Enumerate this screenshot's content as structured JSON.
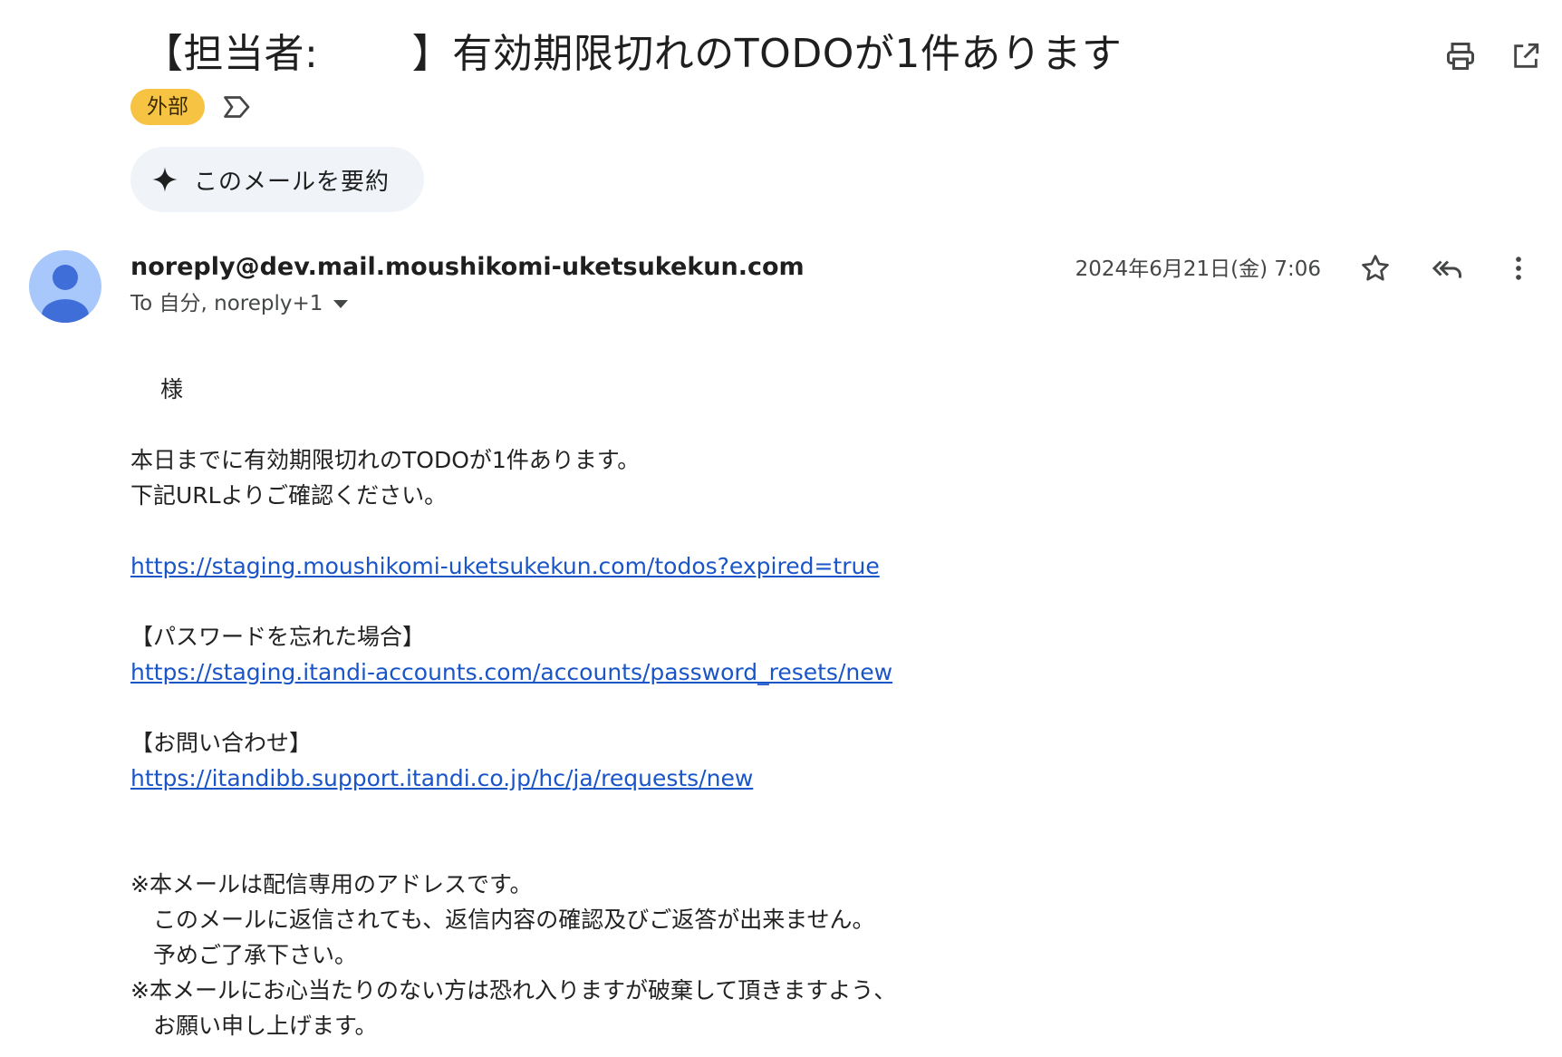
{
  "subject": "【担当者:　　 】有効期限切れのTODOが1件あります",
  "header_icons": {
    "print": "print-icon",
    "open_new": "open-in-new-icon"
  },
  "label": "外部",
  "summary_button": "このメールを要約",
  "sender": "noreply@dev.mail.moushikomi-uketsukekun.com",
  "recipients": "To 自分, noreply+1",
  "date": "2024年6月21日(金) 7:06",
  "colors": {
    "label_bg": "#f6c343",
    "link": "#1a55c7",
    "avatar_bg": "#a8c7fa",
    "avatar_fg": "#3f6ed8",
    "summary_bg": "#f0f4f9"
  },
  "body": {
    "greeting": "　 様",
    "line1": "本日までに有効期限切れのTODOが1件あります。",
    "line2": "下記URLよりご確認ください。",
    "link1": "https://staging.moushikomi-uketsukekun.com/todos?expired=true",
    "password_heading": "【パスワードを忘れた場合】",
    "link2": "https://staging.itandi-accounts.com/accounts/password_resets/new",
    "contact_heading": "【お問い合わせ】",
    "link3": "https://itandibb.support.itandi.co.jp/hc/ja/requests/new",
    "note1": "※本メールは配信専用のアドレスです。",
    "note2": "　このメールに返信されても、返信内容の確認及びご返答が出来ません。",
    "note3": "　予めご了承下さい。",
    "note4": "※本メールにお心当たりのない方は恐れ入りますが破棄して頂きますよう、",
    "note5": "　お願い申し上げます。"
  }
}
